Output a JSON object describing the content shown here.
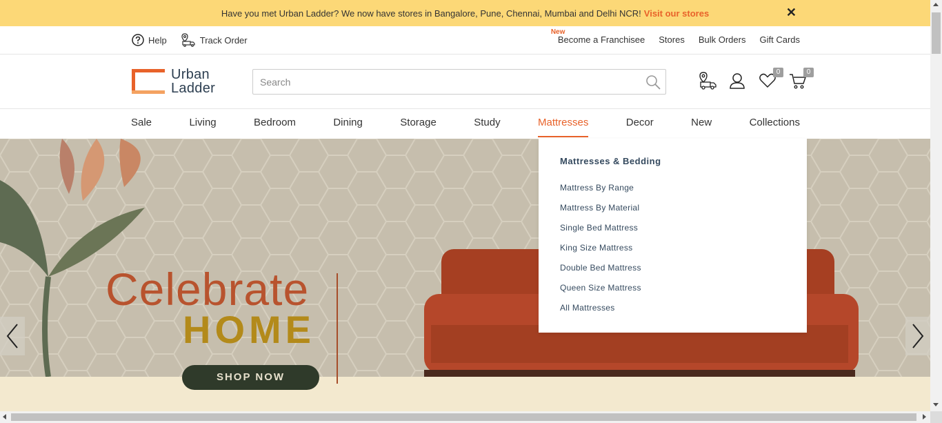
{
  "announcement": {
    "text": "Have you met Urban Ladder? We now have stores in Bangalore, Pune, Chennai, Mumbai and Delhi NCR!",
    "link": "Visit our stores",
    "close": "✕"
  },
  "utility": {
    "help": "Help",
    "track_order": "Track Order",
    "new_tag": "New",
    "links": [
      "Become a Franchisee",
      "Stores",
      "Bulk Orders",
      "Gift Cards"
    ]
  },
  "logo": {
    "line1": "Urban",
    "line2": "Ladder"
  },
  "search": {
    "placeholder": "Search",
    "value": ""
  },
  "header_icons": {
    "wishlist_count": "0",
    "cart_count": "0"
  },
  "nav": {
    "items": [
      "Sale",
      "Living",
      "Bedroom",
      "Dining",
      "Storage",
      "Study",
      "Mattresses",
      "Decor",
      "New",
      "Collections"
    ],
    "active": "Mattresses"
  },
  "dropdown": {
    "heading": "Mattresses & Bedding",
    "items": [
      "Mattress By Range",
      "Mattress By Material",
      "Single Bed Mattress",
      "King Size Mattress",
      "Double Bed Mattress",
      "Queen Size Mattress",
      "All Mattresses"
    ]
  },
  "hero": {
    "title1": "Celebrate",
    "title2": "HOME",
    "cta": "SHOP NOW"
  },
  "colors": {
    "accent": "#e8622a",
    "announce_bg": "#fcd877",
    "text_dark": "#34495e"
  }
}
